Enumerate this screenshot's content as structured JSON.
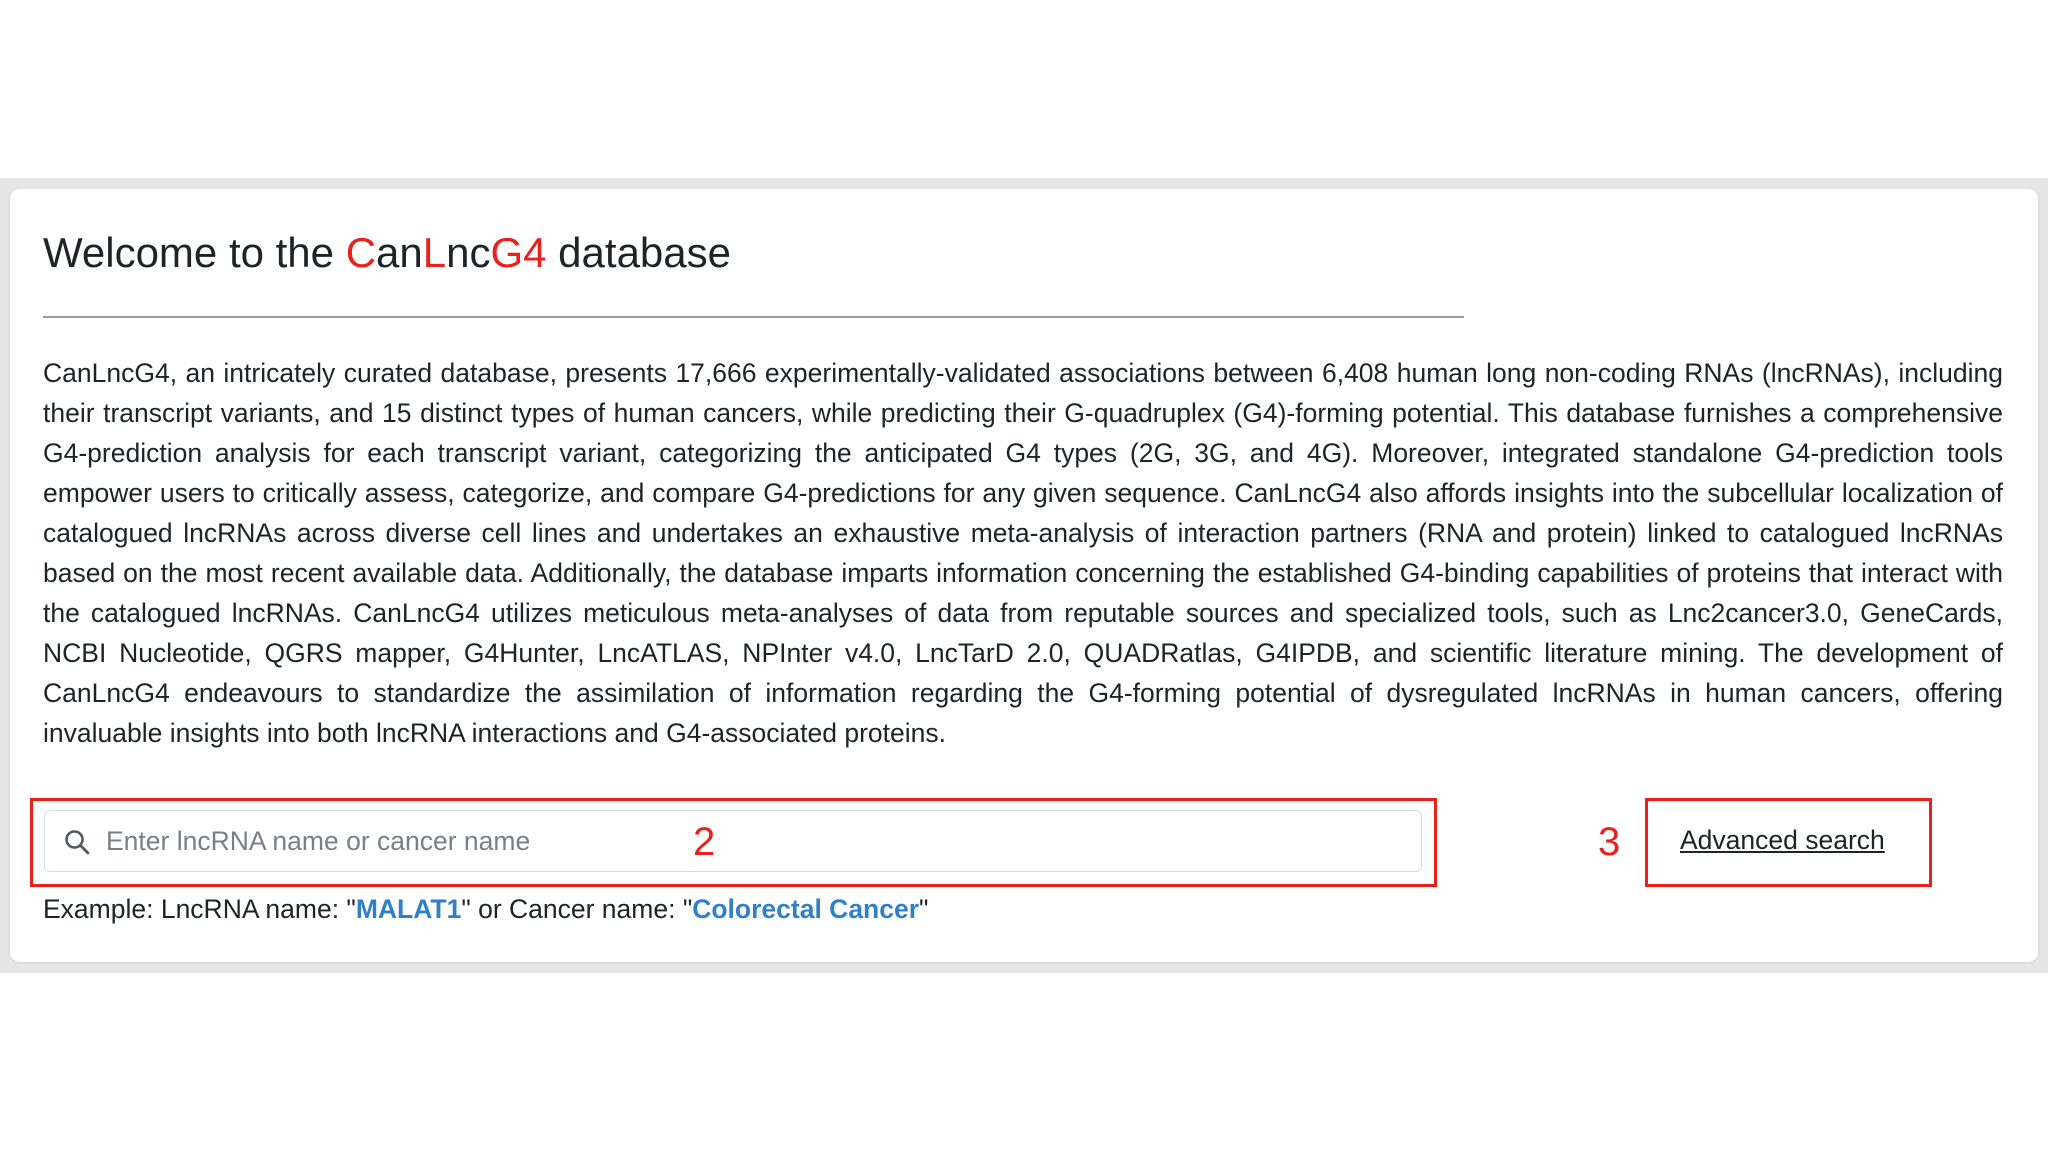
{
  "welcome": {
    "title_prefix": "Welcome to the ",
    "brand_c": "C",
    "brand_an": "an",
    "brand_l": "L",
    "brand_nc": "nc",
    "brand_g4": "G4",
    "title_suffix": " database"
  },
  "description": "CanLncG4, an intricately curated database, presents 17,666 experimentally-validated associations between 6,408 human long non-coding RNAs (lncRNAs), including their transcript variants, and 15 distinct types of human cancers, while predicting their G-quadruplex (G4)-forming potential. This database furnishes a comprehensive G4-prediction analysis for each transcript variant, categorizing the anticipated G4 types (2G, 3G, and 4G). Moreover, integrated standalone G4-prediction tools empower users to critically assess, categorize, and compare G4-predictions for any given sequence. CanLncG4 also affords insights into the subcellular localization of catalogued lncRNAs across diverse cell lines and undertakes an exhaustive meta-analysis of interaction partners (RNA and protein) linked to catalogued lncRNAs based on the most recent available data. Additionally, the database imparts information concerning the established G4-binding capabilities of proteins that interact with the catalogued lncRNAs. CanLncG4 utilizes meticulous meta-analyses of data from reputable sources and specialized tools, such as Lnc2cancer3.0, GeneCards, NCBI Nucleotide, QGRS mapper, G4Hunter, LncATLAS, NPInter v4.0, LncTarD 2.0, QUADRatlas, G4IPDB, and scientific literature mining. The development of CanLncG4 endeavours to standardize the assimilation of information regarding the G4-forming potential of dysregulated lncRNAs in human cancers, offering invaluable insights into both lncRNA interactions and G4-associated proteins.",
  "search": {
    "placeholder": "Enter lncRNA name or cancer name",
    "value": "",
    "icon": "search-icon"
  },
  "advanced_search_label": "Advanced search",
  "example": {
    "prefix": "Example: LncRNA name: \"",
    "lnc_example": "MALAT1",
    "middle": "\" or Cancer name: \"",
    "cancer_example": "Colorectal Cancer",
    "suffix": "\""
  },
  "annotations": {
    "search_marker": "2",
    "advanced_marker": "3"
  },
  "colors": {
    "brand_red": "#e8221b",
    "link_blue": "#2f7fc9",
    "annotation_red": "#e8221b"
  }
}
